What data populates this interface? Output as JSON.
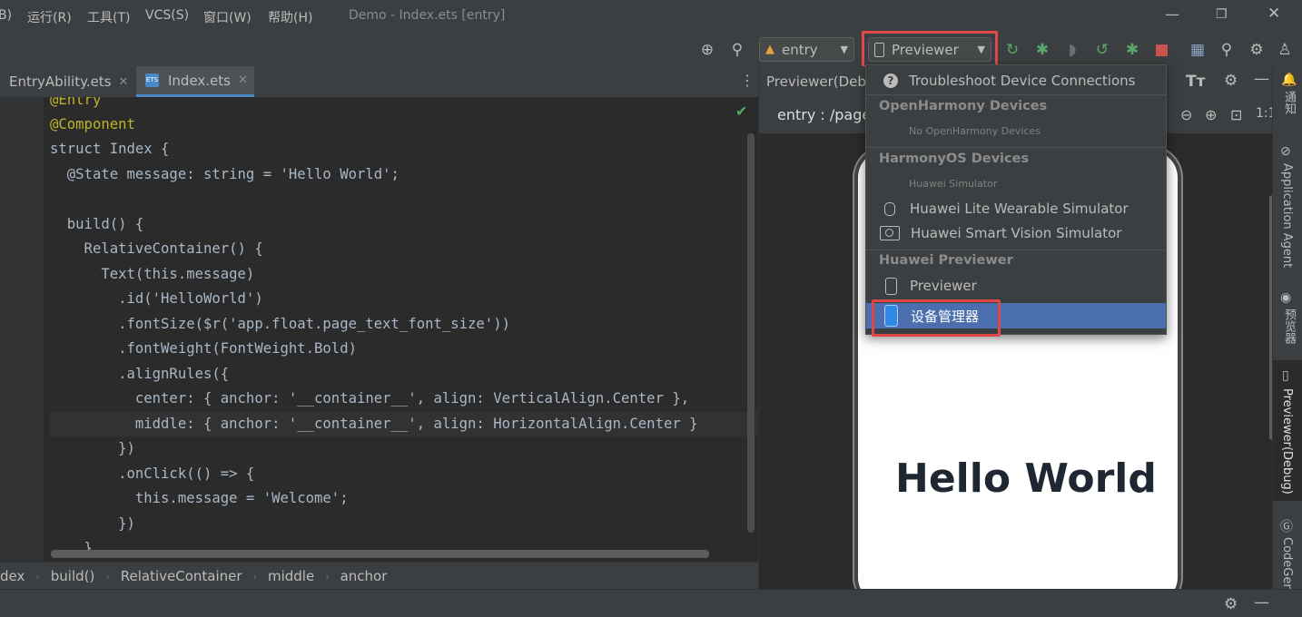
{
  "menu": {
    "items": [
      "B)",
      "运行(R)",
      "工具(T)",
      "VCS(S)",
      "窗口(W)",
      "帮助(H)"
    ],
    "window_title": "Demo - Index.ets [entry]"
  },
  "toolbar": {
    "entry_label": "entry",
    "device_label": "Previewer"
  },
  "tabs": [
    {
      "label": "EntryAbility.ets"
    },
    {
      "label": "Index.ets"
    }
  ],
  "editor": {
    "lines": [
      "@Entry",
      "@Component",
      "struct Index {",
      "  @State message: string = 'Hello World';",
      "",
      "  build() {",
      "    RelativeContainer() {",
      "      Text(this.message)",
      "        .id('HelloWorld')",
      "        .fontSize($r('app.float.page_text_font_size'))",
      "        .fontWeight(FontWeight.Bold)",
      "        .alignRules({",
      "          center: { anchor: '__container__', align: VerticalAlign.Center },",
      "          middle: { anchor: '__container__', align: HorizontalAlign.Center }",
      "        })",
      "        .onClick(() => {",
      "          this.message = 'Welcome';",
      "        })",
      "    }"
    ]
  },
  "breadcrumb": [
    "dex",
    "build()",
    "RelativeContainer",
    "middle",
    "anchor"
  ],
  "preview": {
    "panel_title": "Previewer(Deb",
    "route_label": "entry : /page",
    "hello_text": "Hello World",
    "tt_label": "Tт"
  },
  "popup": {
    "troubleshoot": "Troubleshoot Device Connections",
    "oh_header": "OpenHarmony Devices",
    "oh_none": "No OpenHarmony Devices",
    "hos_header": "HarmonyOS Devices",
    "hos_sub": "Huawei Simulator",
    "wearable": "Huawei Lite Wearable Simulator",
    "vision": "Huawei Smart Vision Simulator",
    "prev_header": "Huawei Previewer",
    "previewer": "Previewer",
    "device_manager": "设备管理器"
  },
  "right_tools": {
    "notifications": "通知",
    "app_agent": "Application Agent",
    "previewer_cn": "预览器",
    "previewer_debug": "Previewer(Debug)",
    "codegenie": "CodeGenie"
  },
  "colors": {
    "highlight_box": "#e04848",
    "selected_row": "#4b6eaf",
    "run_green": "#59a869",
    "stop_red": "#c75450"
  }
}
